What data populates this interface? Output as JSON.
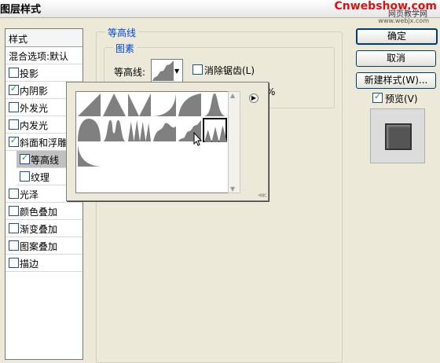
{
  "window": {
    "title": "图层样式",
    "watermark_brand": "Cnwebshow.com",
    "watermark_cn": "网页教学网",
    "watermark_url": "www.webjx.com"
  },
  "style_list": {
    "header": "样式",
    "items": [
      {
        "label": "混合选项:默认",
        "checkbox": false,
        "checked": false
      },
      {
        "label": "投影",
        "checkbox": true,
        "checked": false
      },
      {
        "label": "内阴影",
        "checkbox": true,
        "checked": true
      },
      {
        "label": "外发光",
        "checkbox": true,
        "checked": false
      },
      {
        "label": "内发光",
        "checkbox": true,
        "checked": false
      },
      {
        "label": "斜面和浮雕",
        "checkbox": true,
        "checked": true
      },
      {
        "label": "等高线",
        "checkbox": true,
        "checked": true,
        "sub": true,
        "selected": true
      },
      {
        "label": "纹理",
        "checkbox": true,
        "checked": false,
        "sub": true
      },
      {
        "label": "光泽",
        "checkbox": true,
        "checked": false
      },
      {
        "label": "颜色叠加",
        "checkbox": true,
        "checked": false
      },
      {
        "label": "渐变叠加",
        "checkbox": true,
        "checked": false
      },
      {
        "label": "图案叠加",
        "checkbox": true,
        "checked": false
      },
      {
        "label": "描边",
        "checkbox": true,
        "checked": false
      }
    ]
  },
  "buttons": {
    "ok": "确定",
    "cancel": "取消",
    "new_style": "新建样式(W)...",
    "preview": "预览(V)",
    "preview_checked": true
  },
  "contour_panel": {
    "group_title": "等高线",
    "sub_title": "图素",
    "contour_label": "等高线:",
    "anti_alias_label": "消除锯齿(L)",
    "anti_alias_checked": false,
    "range_suffix": "%"
  },
  "contour_presets": {
    "count": 13,
    "selected_index": 11,
    "shape_names": [
      "linear",
      "cone",
      "cone-inverted",
      "cove-deep",
      "cove-shallow",
      "gaussian",
      "half-round",
      "ring",
      "ring-double",
      "rolling-slope",
      "rounded-steps",
      "sawtooth",
      "cove-inverted"
    ]
  },
  "colors": {
    "dialog_bg": "#ECE9D8",
    "accent_text": "#0046D5",
    "watermark": "#E01010",
    "contour_fill": "#808080"
  }
}
